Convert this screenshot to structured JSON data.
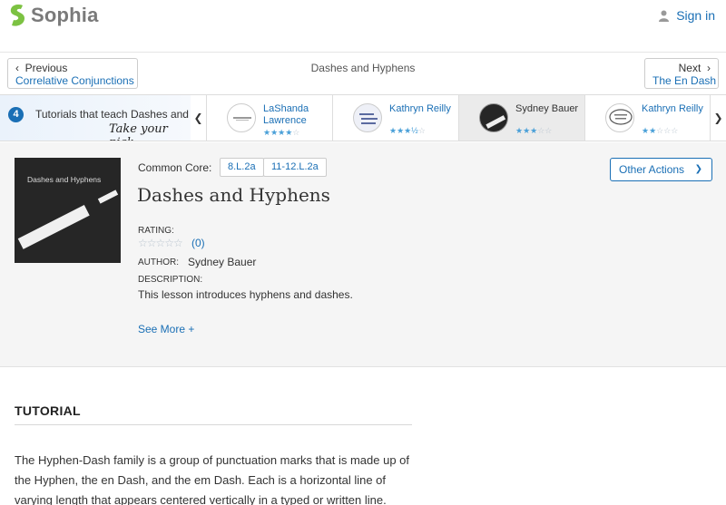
{
  "header": {
    "logo_text": "Sophia",
    "signin_label": "Sign in"
  },
  "lesson_nav": {
    "prev_dir": "Previous",
    "prev_title": "Correlative Conjunctions",
    "center_title": "Dashes and Hyphens",
    "next_dir": "Next",
    "next_title": "The En Dash"
  },
  "tutorials_strip": {
    "count": "4",
    "text": "Tutorials that teach Dashes and",
    "pick_text": "Take your pick:",
    "cards": [
      {
        "name": "LaShanda Lawrence",
        "rating": 4
      },
      {
        "name": "Kathryn Reilly",
        "rating": 3.5
      },
      {
        "name": "Sydney Bauer",
        "rating": 3
      },
      {
        "name": "Kathryn Reilly",
        "rating": 2
      }
    ]
  },
  "lesson": {
    "image_title": "Dashes and Hyphens",
    "common_core_label": "Common Core:",
    "standards": [
      "8.L.2a",
      "11-12.L.2a"
    ],
    "title": "Dashes and Hyphens",
    "other_actions_label": "Other Actions",
    "rating_label": "RATING:",
    "rating_stars": "☆☆☆☆☆",
    "rating_count": "(0)",
    "author_label": "AUTHOR:",
    "author": "Sydney Bauer",
    "description_label": "DESCRIPTION:",
    "description": "This lesson introduces hyphens and dashes.",
    "see_more_label": "See More +"
  },
  "tutorial": {
    "heading": "TUTORIAL",
    "paragraph": "The Hyphen-Dash family is a group of punctuation marks that is made up of the Hyphen, the en Dash, and the em Dash. Each is a horizontal line of varying length that appears centered vertically in a typed or written line."
  },
  "colors": {
    "link": "#1a6fb5",
    "star_active": "#4aa0d8",
    "logo_green": "#7cc242"
  }
}
